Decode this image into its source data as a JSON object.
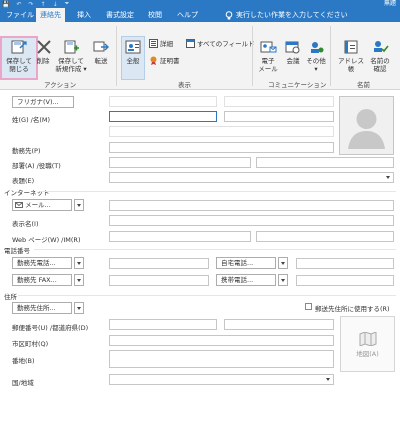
{
  "window": {
    "signin": "無題"
  },
  "qat": {
    "save": "💾",
    "undo": "↶",
    "redo": "↷",
    "up": "↑",
    "down": "↓",
    "more": "⏷"
  },
  "tabs": [
    "ファイル",
    "連絡先",
    "挿入",
    "書式設定",
    "校閲",
    "ヘルプ"
  ],
  "tell_me": "実行したい作業を入力してください",
  "ribbon": {
    "save_close": [
      "保存して",
      "閉じる"
    ],
    "delete": "削除",
    "save_new": [
      "保存して",
      "新規作成 ▾"
    ],
    "forward": "転送",
    "group_action": "アクション",
    "general": "全般",
    "details": "詳細",
    "certificate": "証明書",
    "all_fields": "すべてのフィールド",
    "group_show": "表示",
    "email": [
      "電子",
      "メール"
    ],
    "meeting": "会議",
    "other": [
      "その他",
      "▾"
    ],
    "group_comm": "コミュニケーション",
    "address_book": "アドレス帳",
    "check_names": [
      "名前の",
      "確認"
    ],
    "group_names": "名前"
  },
  "form": {
    "furigana_btn": "フリガナ(V)...",
    "name_label": "姓(G) /名(M)",
    "company_label": "勤務先(P)",
    "dept_label": "部署(A) /役職(T)",
    "fileas_label": "表題(E)",
    "internet_section": "インターネット",
    "email_btn": "メール...",
    "display_label": "表示名(I)",
    "web_label": "Web ページ(W) /IM(R)",
    "phone_section": "電話番号",
    "phone1_btn": "勤務先電話...",
    "phone2_btn": "自宅電話...",
    "phone3_btn": "勤務先 FAX...",
    "phone4_btn": "携帯電話...",
    "address_section": "住所",
    "address_btn": "勤務先住所...",
    "mailing_check": "郵送先住所に使用する(R)",
    "zip_label": "郵便番号(U) /都道府県(D)",
    "city_label": "市区町村(Q)",
    "street_label": "番地(B)",
    "country_label": "国/地域",
    "map_btn": "地図(A)"
  }
}
